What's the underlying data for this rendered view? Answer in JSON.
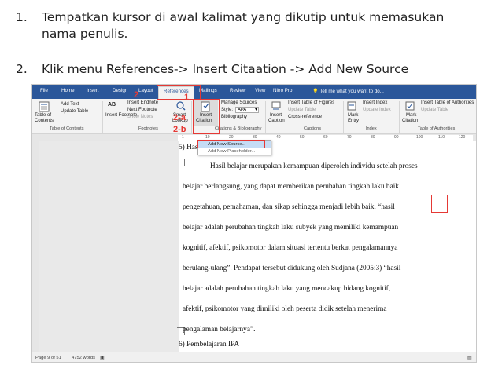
{
  "instructions": [
    {
      "num": "1.",
      "line1": "Tempatkan kursor di awal kalimat yang dikutip untuk memasukan",
      "line2": "nama penulis."
    },
    {
      "num": "2.",
      "line1": "Klik menu References-> Insert Citaation -> Add New Source"
    }
  ],
  "menubar": {
    "tabs": [
      "File",
      "Home",
      "Insert",
      "Design",
      "Layout",
      "References",
      "Mailings",
      "Review",
      "View",
      "Nitro Pro"
    ],
    "active_tab": "References",
    "tell_me": "Tell me what you want to do...",
    "color": "#2b579a"
  },
  "ribbon": {
    "toc": {
      "label1": "Table of",
      "label2": "Contents",
      "add_text": "Add Text",
      "update_table": "Update Table",
      "group": "Table of Contents"
    },
    "footnotes": {
      "insert_footnote": "Insert Footnote",
      "insert_endnote": "Insert Endnote",
      "next_footnote": "Next Footnote",
      "show_notes": "Show Notes",
      "ab_glyph": "AB",
      "group": "Footnotes"
    },
    "research": {
      "smart_lookup1": "Smart",
      "smart_lookup2": "Lookup"
    },
    "citations": {
      "insert_citation1": "Insert",
      "insert_citation2": "Citation",
      "manage_sources": "Manage Sources",
      "style_label": "Style:",
      "style_value": "APA",
      "bibliography": "Bibliography",
      "group": "Citations & Bibliography"
    },
    "captions": {
      "insert_caption1": "Insert",
      "insert_caption2": "Caption",
      "insert_table_of_figures": "Insert Table of Figures",
      "update_table": "Update Table",
      "cross_reference": "Cross-reference",
      "group": "Captions"
    },
    "index": {
      "mark_entry1": "Mark",
      "mark_entry2": "Entry",
      "insert_index": "Insert Index",
      "update_index": "Update Index",
      "group": "Index"
    },
    "authorities": {
      "mark_citation1": "Mark",
      "mark_citation2": "Citation",
      "insert_table_of_authorities": "Insert Table of Authorities",
      "update_table": "Update Table",
      "group": "Table of Authorities"
    }
  },
  "ruler": {
    "ticks": [
      "1",
      "10",
      "20",
      "30",
      "40",
      "50",
      "60",
      "70",
      "80",
      "90",
      "100",
      "110",
      "120"
    ]
  },
  "citation_menu": {
    "items": [
      "Add New Source...",
      "Add New Placeholder..."
    ]
  },
  "document": {
    "lines": [
      "5)  Hasil Belajar",
      "Hasil belajar merupakan kemampuan diperoleh individu setelah proses",
      "belajar berlangsung, yang dapat memberikan perubahan tingkah laku baik",
      "pengetahuan, pemahaman, dan sikap sehingga menjadi lebih baik. “hasil",
      "belajar adalah perubahan tingkah laku subyek yang memiliki kemampuan",
      "kognitif, afektif, psikomotor dalam situasi tertentu berkat pengalamannya",
      "berulang-ulang”. Pendapat tersebut didukung oleh Sudjana (2005:3) “hasil",
      "belajar adalah perubahan tingkah laku yang mencakup bidang kognitif,",
      "afektif, psikomotor yang dimiliki oleh peserta didik setelah menerima",
      "pengalaman belajarnya”.",
      "6)  Pembelajaran IPA"
    ]
  },
  "statusbar": {
    "page": "Page 9 of 51",
    "words": "4752 words"
  },
  "callouts": {
    "c1": "1",
    "c2": "2",
    "c2a": "2-a",
    "c2b": "2-b"
  },
  "annotation_color": "#e53935"
}
